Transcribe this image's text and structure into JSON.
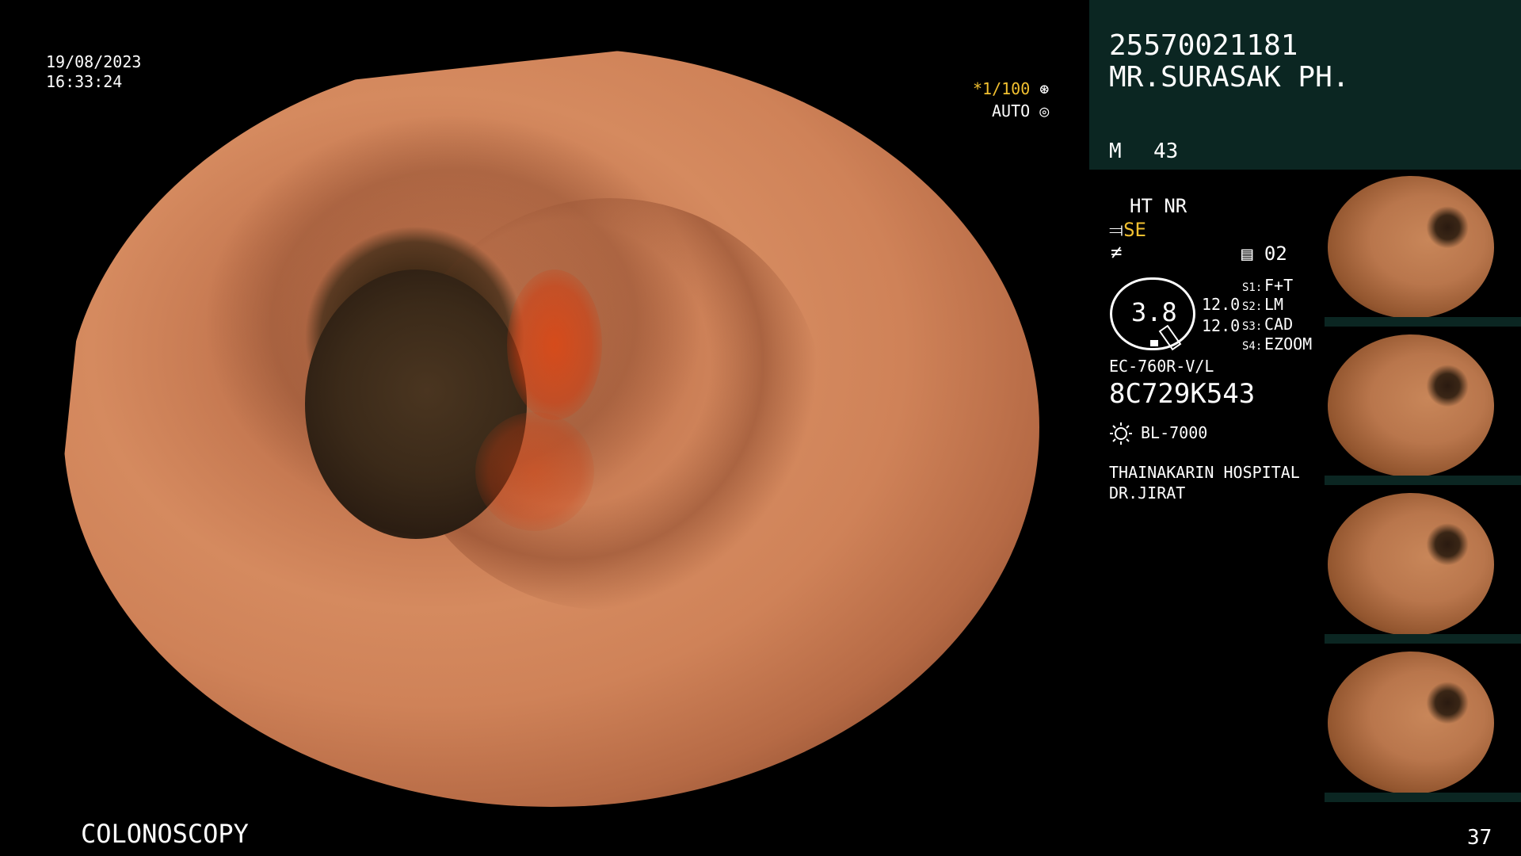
{
  "datetime": {
    "date": "19/08/2023",
    "time": "16:33:24"
  },
  "patient": {
    "id": "25570021181",
    "name": "MR.SURASAK PH.",
    "sex": "M",
    "age": "43"
  },
  "imaging": {
    "shutter": "*1/100",
    "exposure_mode": "AUTO",
    "ht": "HT NR",
    "enhance": "SE",
    "zoom_badge": "02",
    "gauge_value": "3.8",
    "values": [
      "12.0",
      "12.0"
    ],
    "switches": [
      {
        "label": "S1:",
        "value": "F+T"
      },
      {
        "label": "S2:",
        "value": "LM"
      },
      {
        "label": "S3:",
        "value": "CAD"
      },
      {
        "label": "S4:",
        "value": "EZOOM"
      }
    ]
  },
  "scope": {
    "model": "EC-760R-V/L",
    "serial": "8C729K543",
    "light_source": "BL-7000"
  },
  "facility": {
    "hospital": "THAINAKARIN HOSPITAL",
    "doctor": "DR.JIRAT"
  },
  "procedure": "COLONOSCOPY",
  "page_number": "37",
  "icons": [
    "shutter-icon",
    "auto-iris-icon",
    "structure-enhance-icon",
    "freeze-icon",
    "memory-icon",
    "light-source-icon"
  ],
  "colors": {
    "panel_bg": "#0b2622",
    "highlight": "#f2c030"
  }
}
